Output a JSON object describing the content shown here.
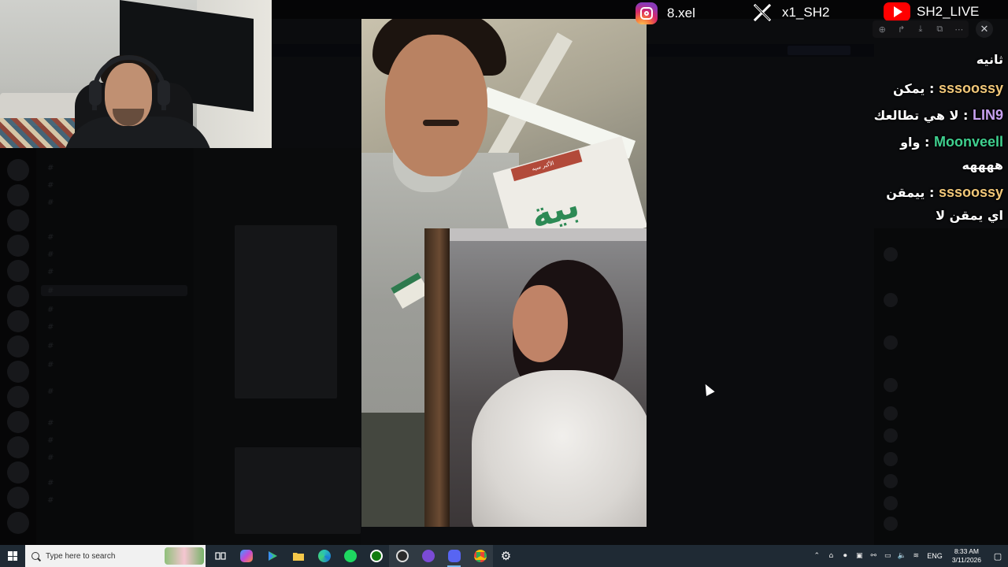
{
  "socials": {
    "instagram": "8.xel",
    "x": "x1_SH2",
    "youtube": "SH2_LIVE"
  },
  "viewer_tools": {
    "zoom_icon": "zoom-in-icon",
    "forward_icon": "forward-icon",
    "download_icon": "download-icon",
    "open_icon": "open-external-icon",
    "more_icon": "more-icon",
    "close_icon": "close-icon"
  },
  "stream_chat": [
    {
      "user": "",
      "user_color": "#ffffff",
      "message": "ثانيه"
    },
    {
      "user": "sssoossy",
      "user_color": "#f2c879",
      "message": "يمكن"
    },
    {
      "user": "LIN9",
      "user_color": "#c7a1f0",
      "message": "لا هي تطالعك"
    },
    {
      "user": "Moonveell",
      "user_color": "#3fd08f",
      "message": "واو"
    },
    {
      "user": "",
      "user_color": "#ffffff",
      "message": "ههههه"
    },
    {
      "user": "sssoossy",
      "user_color": "#f2c879",
      "message": "ييمقن"
    },
    {
      "user": "",
      "user_color": "#ffffff",
      "message": "اي يمقن لا"
    }
  ],
  "viewer_image": {
    "book_title": "بية",
    "book_band": "الأكبر سيه"
  },
  "taskbar": {
    "search_placeholder": "Type here to search",
    "language": "ENG",
    "time": "8:33 AM",
    "date": "3/11/2026"
  },
  "colors": {
    "taskbar": "#1f2a34",
    "youtube_red": "#ff0000",
    "accent_blue": "#76b9ed"
  }
}
